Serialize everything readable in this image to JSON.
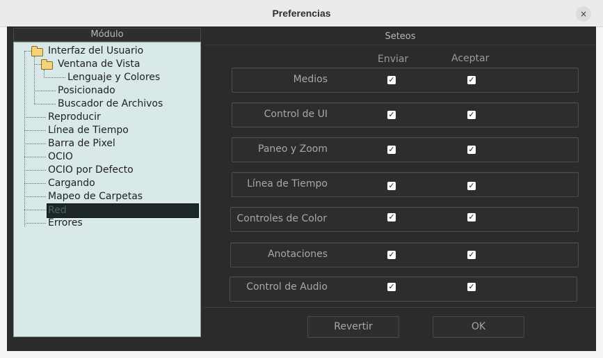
{
  "window": {
    "title": "Preferencias"
  },
  "icons": {
    "close": "×"
  },
  "left_panel": {
    "header": "Módulo",
    "tree": [
      "Interfaz del Usuario",
      "Ventana de Vista",
      "Lenguaje y Colores",
      "Posicionado",
      "Buscador de Archivos",
      "Reproducir",
      "Línea de Tiempo",
      "Barra de Pixel",
      "OCIO",
      "OCIO por Defecto",
      "Cargando",
      "Mapeo de Carpetas",
      "Red",
      "Errores"
    ],
    "selected": "Red"
  },
  "right_panel": {
    "header": "Seteos",
    "columns": [
      "Enviar",
      "Aceptar"
    ],
    "rows": [
      {
        "label": "Medios",
        "enviar": true,
        "aceptar": true
      },
      {
        "label": "Control de UI",
        "enviar": true,
        "aceptar": true
      },
      {
        "label": "Paneo y Zoom",
        "enviar": true,
        "aceptar": true
      },
      {
        "label": "Línea de Tiempo",
        "enviar": true,
        "aceptar": true
      },
      {
        "label": "Controles de Color",
        "enviar": true,
        "aceptar": true
      },
      {
        "label": "Anotaciones",
        "enviar": true,
        "aceptar": true
      },
      {
        "label": "Control de Audio",
        "enviar": true,
        "aceptar": true
      }
    ],
    "checkmark": "✓"
  },
  "buttons": {
    "revert": "Revertir",
    "ok": "OK"
  },
  "colors": {
    "tree_bg": "#d9e8e8",
    "panel_bg": "#2b2b2b",
    "selected_bg": "#1e2727"
  }
}
